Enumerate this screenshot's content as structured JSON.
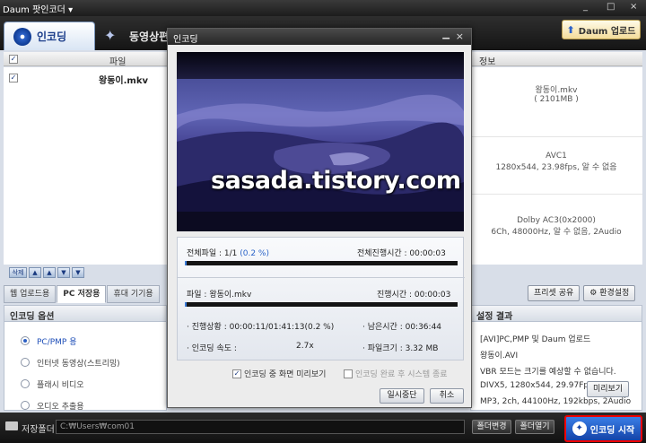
{
  "window": {
    "title": "Daum 팟인코더 ▾",
    "controls": [
      "_",
      "□",
      "×"
    ]
  },
  "tabs": [
    {
      "label": "인코딩",
      "icon": "disc-icon",
      "active": true
    },
    {
      "label": "동영상편",
      "icon": "film-reel-icon",
      "active": false
    }
  ],
  "update_button": {
    "label": "Daum 업로드",
    "icon": "upload-arrow-icon"
  },
  "file_list": {
    "header_file": "파일",
    "header_info": "정보",
    "rows": [
      {
        "checked": true,
        "name": "왕동이.mkv"
      }
    ]
  },
  "info_pane": {
    "file": "왕동이.mkv",
    "size": "( 2101MB )",
    "video_codec": "AVC1",
    "video_detail": "1280x544, 23.98fps, 알 수 없음",
    "audio_codec": "Dolby AC3(0x2000)",
    "audio_detail": "6Ch, 48000Hz, 알 수 없음, 2Audio"
  },
  "list_tools": {
    "delete": "삭제",
    "icons": [
      "▲",
      "▲",
      "▼",
      "▼"
    ]
  },
  "subtabs": [
    "웹 업로드용",
    "PC 저장용",
    "휴대 기기용"
  ],
  "preset_buttons": {
    "share": "프리셋 공유",
    "settings": "환경설정"
  },
  "options": {
    "title": "인코딩 옵션",
    "items": [
      {
        "label": "PC/PMP 용",
        "selected": true
      },
      {
        "label": "인터넷 동영상(스트리밍)",
        "selected": false
      },
      {
        "label": "플래시 비디오",
        "selected": false
      },
      {
        "label": "오디오 추출용",
        "selected": false
      }
    ]
  },
  "result": {
    "title": "설정 결과",
    "lines": [
      "[AVI]PC,PMP 및 Daum 업로드",
      "왕동이.AVI",
      "VBR 모드는 크기를 예상할 수 없습니다.",
      "DIVX5, 1280x544, 29.97Fps, 0kbps",
      "MP3, 2ch, 44100Hz, 192kbps, 2Audio"
    ],
    "preview_button": "미리보기"
  },
  "bottom": {
    "folder_label": "저장폴더",
    "path": "C:₩Users₩com01",
    "change_button": "폴더변경",
    "open_button": "폴더열기",
    "start_button": "인코딩 시작"
  },
  "dialog": {
    "title": "인코딩",
    "watermark": "sasada.tistory.com",
    "total_files_label": "전체파일 : 1/1",
    "total_percent": "(0.2 %)",
    "total_percent_value": 0.2,
    "total_time": "전체진행시간 :  00:00:03",
    "current_file": "파일 : 왕동이.mkv",
    "current_time": "진행시간 :  00:00:03",
    "file_percent_value": 0.2,
    "status": "· 진행상황 :  00:00:11/01:41:13(0.2 %)",
    "remain": "· 남은시간 :  00:36:44",
    "speed_label": "· 인코딩 속도 :",
    "speed_value": "2.7x",
    "filesize": "· 파일크기 :  3.32 MB",
    "preview_check": "인코딩 중 화면 미리보기",
    "shutdown_check": "인코딩 완료 후 시스템 종료",
    "pause_button": "일시중단",
    "cancel_button": "취소"
  }
}
